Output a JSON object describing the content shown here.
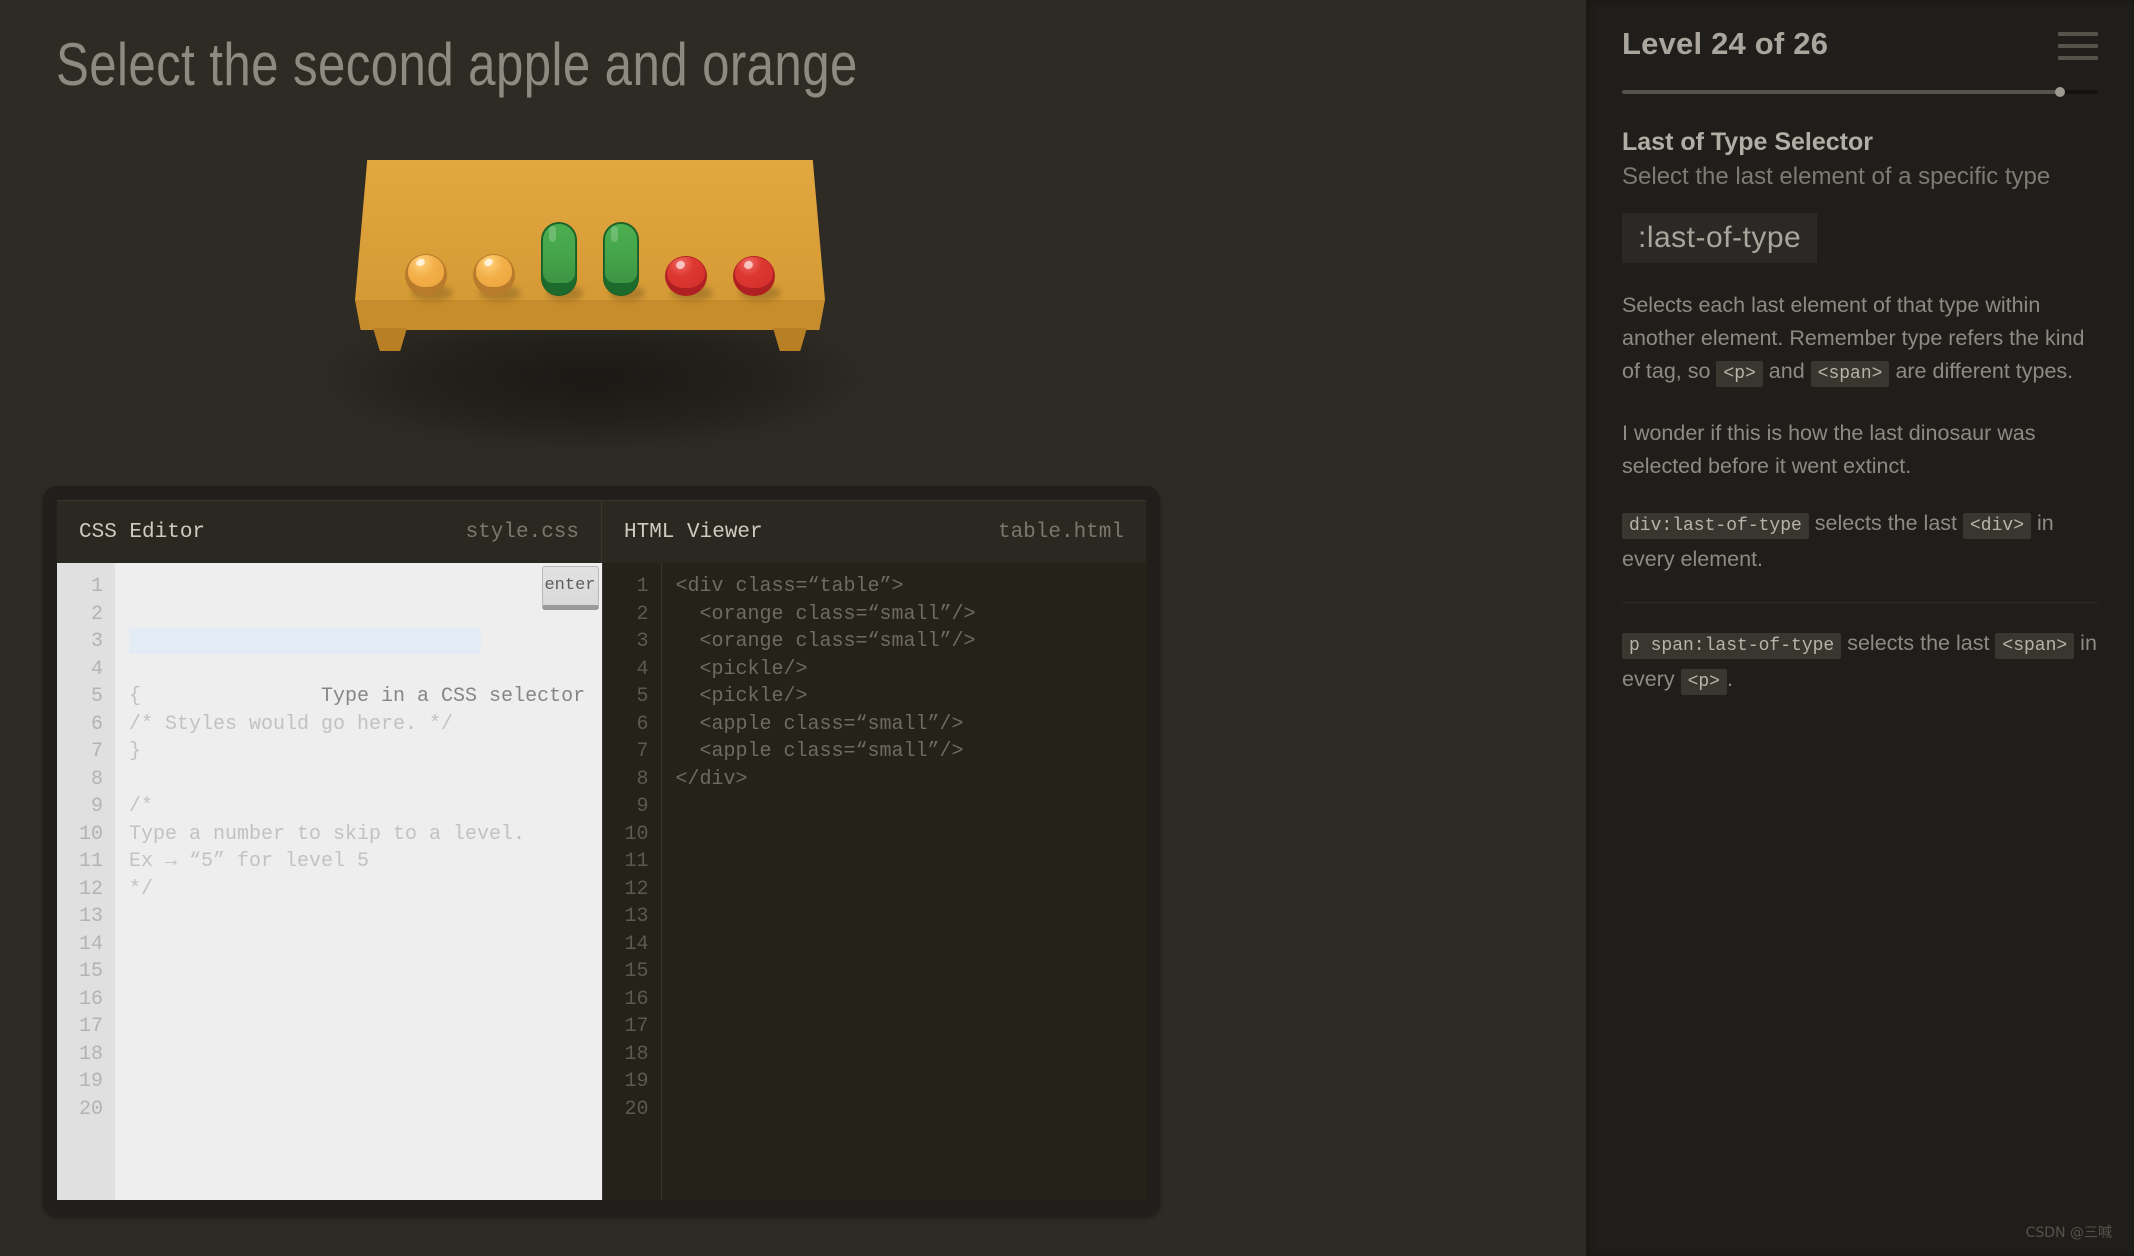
{
  "game": {
    "order_text": "Select the second apple and orange",
    "table": {
      "items": [
        {
          "type": "orange",
          "label": "orange-1"
        },
        {
          "type": "orange",
          "label": "orange-2"
        },
        {
          "type": "pickle",
          "label": "pickle-1"
        },
        {
          "type": "pickle",
          "label": "pickle-2"
        },
        {
          "type": "apple",
          "label": "apple-1"
        },
        {
          "type": "apple",
          "label": "apple-2"
        }
      ],
      "colors": {
        "wood_top": "#e2a73f",
        "wood_front": "#c78c2c",
        "orange": "#f2ae48",
        "pickle": "#43a047",
        "apple": "#d22e2b"
      }
    }
  },
  "editor": {
    "css": {
      "tab_title": "CSS Editor",
      "file_name": "style.css",
      "input_placeholder": "Type in a CSS selector",
      "input_value": "",
      "enter_label": "enter",
      "lines": [
        "{",
        "/* Styles would go here. */",
        "}",
        "",
        "/*",
        "Type a number to skip to a level.",
        "Ex → “5” for level 5",
        "*/"
      ],
      "gutter": [
        "1",
        "2",
        "3",
        "4",
        "5",
        "6",
        "7",
        "8",
        "9",
        "10",
        "11",
        "12",
        "13",
        "14",
        "15",
        "16",
        "17",
        "18",
        "19",
        "20"
      ]
    },
    "html": {
      "tab_title": "HTML Viewer",
      "file_name": "table.html",
      "lines": [
        "<div class=“table”>",
        "  <orange class=“small”/>",
        "  <orange class=“small”/>",
        "  <pickle/>",
        "  <pickle/>",
        "  <apple class=“small”/>",
        "  <apple class=“small”/>",
        "</div>"
      ],
      "gutter": [
        "1",
        "2",
        "3",
        "4",
        "5",
        "6",
        "7",
        "8",
        "9",
        "10",
        "11",
        "12",
        "13",
        "14",
        "15",
        "16",
        "17",
        "18",
        "19",
        "20"
      ]
    }
  },
  "sidebar": {
    "level_label": "Level 24 of 26",
    "progress_percent": 92,
    "menu_icon": "hamburger-icon",
    "help": {
      "title": "Last of Type Selector",
      "subtitle": "Select the last element of a specific type",
      "selector": ":last-of-type",
      "paragraph1_a": "Selects each last element of that type within another element. Remember type refers the kind of tag, so ",
      "paragraph1_code1": "<p>",
      "paragraph1_b": " and ",
      "paragraph1_code2": "<span>",
      "paragraph1_c": " are different types.",
      "paragraph2": "I wonder if this is how the last dinosaur was selected before it went extinct.",
      "example1_code": "div:last-of-type",
      "example1_a": " selects the last ",
      "example1_code2": "<div>",
      "example1_b": " in every element.",
      "example2_code": "p span:last-of-type",
      "example2_a": " selects the last ",
      "example2_code2": "<span>",
      "example2_b": " in every ",
      "example2_code3": "<p>",
      "example2_c": "."
    }
  },
  "watermark": "CSDN @三喊"
}
